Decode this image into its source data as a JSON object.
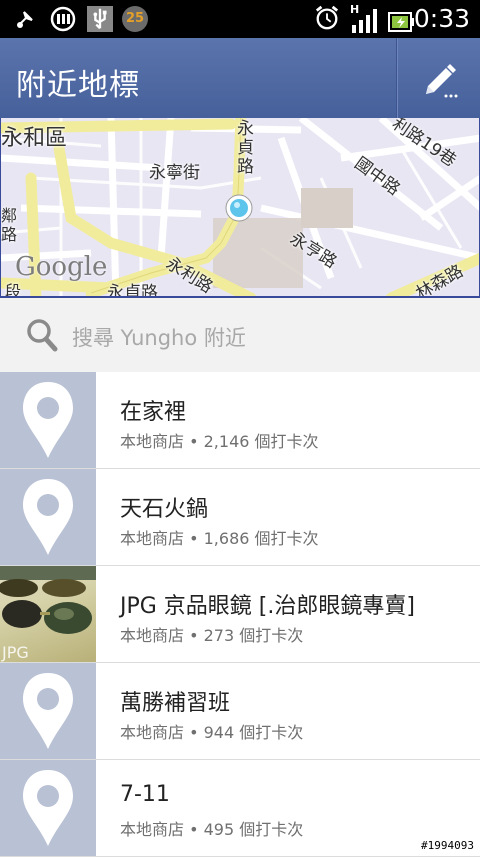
{
  "status_bar": {
    "time": "0:33",
    "network_type": "H",
    "badge_number": "25",
    "icons": [
      "usb-debug-icon",
      "rss-icon",
      "usb-icon",
      "badge-icon",
      "alarm-icon",
      "signal-icon",
      "battery-icon"
    ]
  },
  "header": {
    "title": "附近地標",
    "edit_icon": "pencil-icon"
  },
  "map": {
    "labels": [
      "永和區",
      "永寧街",
      "永貞路",
      "國中路",
      "永亨路",
      "永利路",
      "永貞路",
      "林森路",
      "利路19巷",
      "鄰路",
      "段"
    ],
    "attribution": "Google",
    "marker": "current-location-dot"
  },
  "search": {
    "placeholder": "搜尋 Yungho 附近"
  },
  "places": [
    {
      "name": "在家裡",
      "category": "本地商店",
      "checkins": "2,146 個打卡次"
    },
    {
      "name": "天石火鍋",
      "category": "本地商店",
      "checkins": "1,686 個打卡次"
    },
    {
      "name": "JPG 京品眼鏡 [.治郎眼鏡專賣]",
      "category": "本地商店",
      "checkins": "273 個打卡次"
    },
    {
      "name": "萬勝補習班",
      "category": "本地商店",
      "checkins": "944 個打卡次"
    },
    {
      "name": "7-11",
      "category": "本地商店",
      "checkins": "495 個打卡次"
    }
  ],
  "separator": " • ",
  "watermark": "#1994093",
  "colors": {
    "header": "#4f69a4",
    "placeholder_thumb": "#b9c1d4",
    "map_road": "#f3efa8",
    "map_bg": "#e9e6f3"
  }
}
